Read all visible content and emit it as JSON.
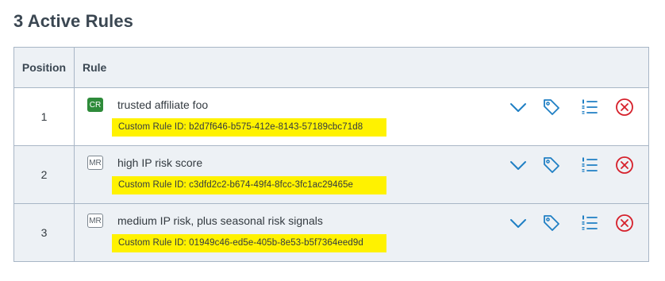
{
  "header": {
    "title": "3 Active Rules"
  },
  "table": {
    "columns": [
      "Position",
      "Rule"
    ],
    "rows": [
      {
        "position": "1",
        "badge": "CR",
        "name": "trusted affiliate foo",
        "id_text": "Custom Rule ID: b2d7f646-b575-412e-8143-57189cbc71d8"
      },
      {
        "position": "2",
        "badge": "MR",
        "name": "high IP risk score",
        "id_text": "Custom Rule ID: c3dfd2c2-b674-49f4-8fcc-3fc1ac29465e"
      },
      {
        "position": "3",
        "badge": "MR",
        "name": "medium IP risk, plus seasonal risk signals",
        "id_text": "Custom Rule ID: 01949c46-ed5e-405b-8e53-b5f7364eed9d"
      }
    ],
    "row_actions": [
      "chevron-down-icon",
      "tag-icon",
      "numbered-list-icon",
      "remove-circle-icon"
    ]
  },
  "colors": {
    "accent": "#1f7fc4",
    "danger": "#d6202b",
    "cr_badge": "#2e8b3a",
    "highlight": "#fff200",
    "header_bg": "#edf1f5",
    "border": "#a8b6c6"
  }
}
